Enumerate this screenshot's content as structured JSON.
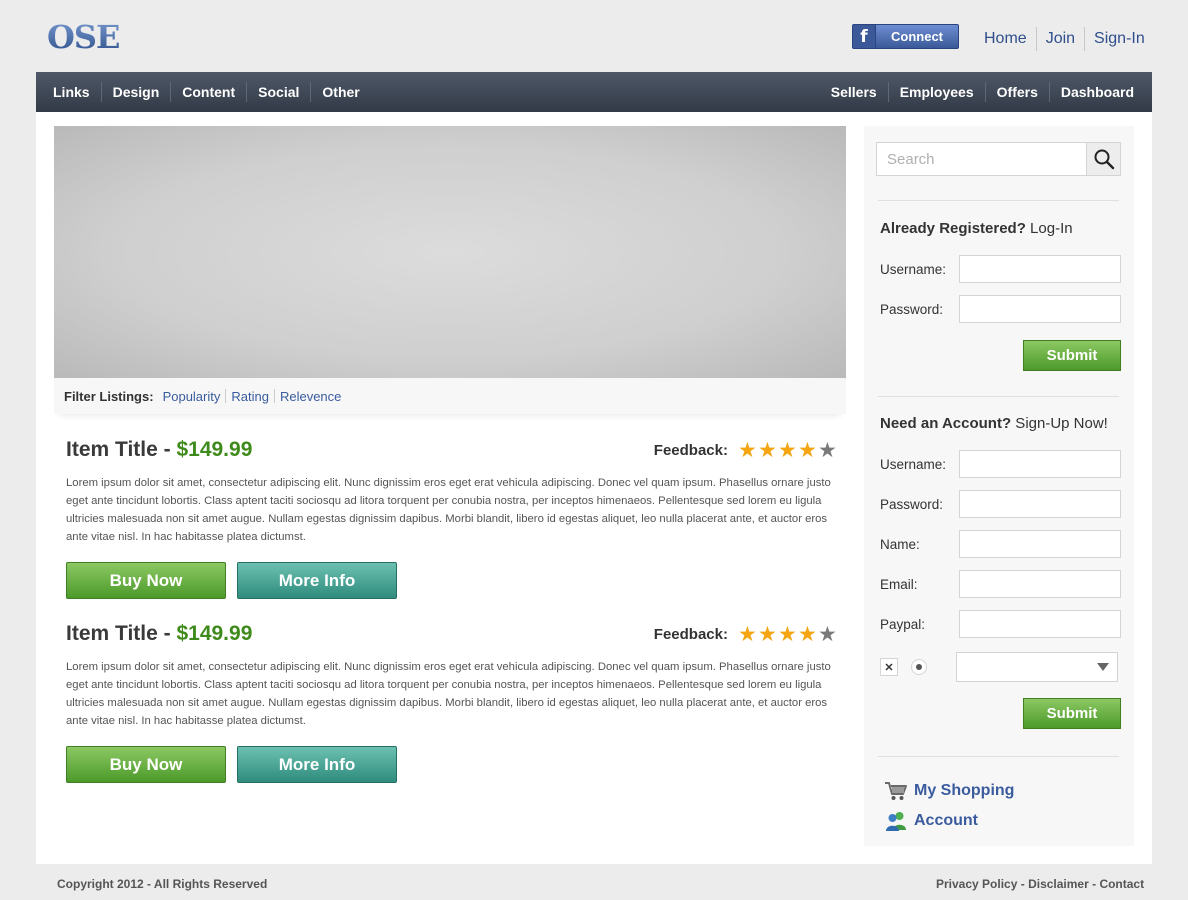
{
  "header": {
    "logo": "OSE",
    "facebook_connect": {
      "icon": "f",
      "label": "Connect"
    },
    "links": [
      "Home",
      "Join",
      "Sign-In"
    ]
  },
  "nav": {
    "left": [
      "Links",
      "Design",
      "Content",
      "Social",
      "Other"
    ],
    "right": [
      "Sellers",
      "Employees",
      "Offers",
      "Dashboard"
    ]
  },
  "filter": {
    "label": "Filter Listings:",
    "options": [
      "Popularity",
      "Rating",
      "Relevence"
    ]
  },
  "items": [
    {
      "title": "Item Title - ",
      "price": "$149.99",
      "feedback_label": "Feedback:",
      "rating": 4,
      "rating_max": 5,
      "description": "Lorem ipsum dolor sit amet, consectetur adipiscing elit. Nunc dignissim eros eget erat vehicula adipiscing. Donec vel quam ipsum. Phasellus ornare justo eget ante tincidunt lobortis. Class aptent taciti sociosqu ad litora torquent per conubia nostra, per inceptos himenaeos. Pellentesque sed lorem eu ligula ultricies malesuada non sit amet augue. Nullam egestas dignissim dapibus. Morbi blandit, libero id egestas aliquet, leo nulla placerat ante, et auctor eros ante vitae nisl. In hac habitasse platea dictumst.",
      "buy_label": "Buy Now",
      "info_label": "More Info"
    },
    {
      "title": "Item Title - ",
      "price": "$149.99",
      "feedback_label": "Feedback:",
      "rating": 4,
      "rating_max": 5,
      "description": "Lorem ipsum dolor sit amet, consectetur adipiscing elit. Nunc dignissim eros eget erat vehicula adipiscing. Donec vel quam ipsum. Phasellus ornare justo eget ante tincidunt lobortis. Class aptent taciti sociosqu ad litora torquent per conubia nostra, per inceptos himenaeos. Pellentesque sed lorem eu ligula ultricies malesuada non sit amet augue. Nullam egestas dignissim dapibus. Morbi blandit, libero id egestas aliquet, leo nulla placerat ante, et auctor eros ante vitae nisl. In hac habitasse platea dictumst.",
      "buy_label": "Buy Now",
      "info_label": "More Info"
    }
  ],
  "sidebar": {
    "search": {
      "placeholder": "Search",
      "value": "",
      "icon": "search-icon"
    },
    "login": {
      "heading_bold": "Already Registered?",
      "heading_rest": " Log-In",
      "username_label": "Username:",
      "password_label": "Password:",
      "submit_label": "Submit"
    },
    "signup": {
      "heading_bold": "Need an Account?",
      "heading_rest": " Sign-Up Now!",
      "username_label": "Username:",
      "password_label": "Password:",
      "name_label": "Name:",
      "email_label": "Email:",
      "paypal_label": "Paypal:",
      "checkbox_mark": "✕",
      "select_value": "",
      "submit_label": "Submit"
    },
    "links": [
      {
        "label": "My Shopping",
        "icon": "cart-icon"
      },
      {
        "label": "Account",
        "icon": "users-icon"
      }
    ]
  },
  "footer": {
    "copyright": "Copyright 2012 - All Rights Reserved",
    "links": [
      "Privacy Policy",
      "Disclaimer",
      "Contact"
    ],
    "separator": " - "
  },
  "colors": {
    "nav_bg": "#3f4756",
    "link_blue": "#3a5c9e",
    "price_green": "#3f8a1c",
    "buy_green": "#6bb146",
    "info_teal": "#45a899",
    "star_on": "#f4a511",
    "star_off": "#7a7a7a"
  }
}
